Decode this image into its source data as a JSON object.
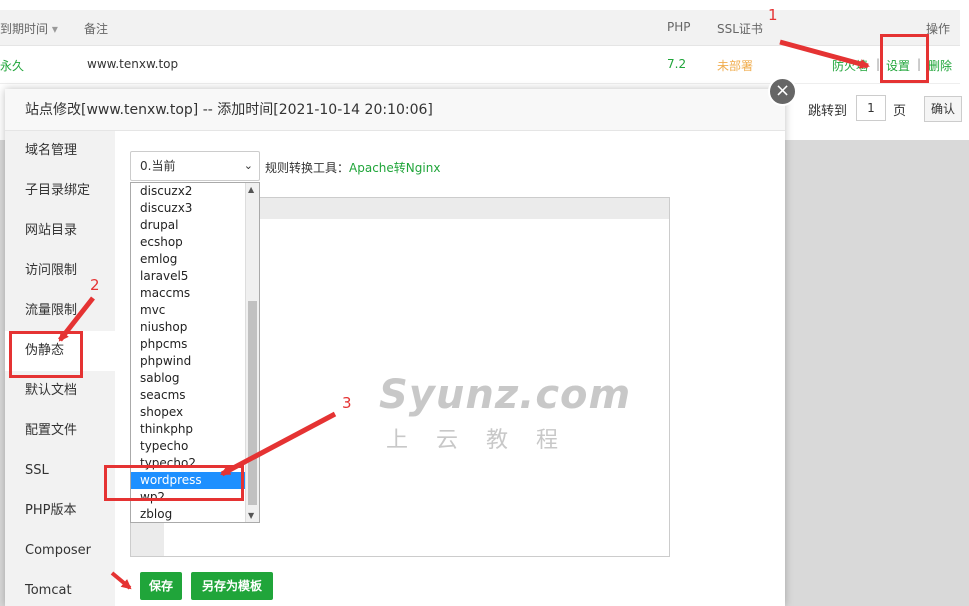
{
  "table": {
    "headers": {
      "expire": "到期时间",
      "note": "备注",
      "php": "PHP",
      "ssl": "SSL证书",
      "ops": "操作"
    },
    "row": {
      "expire": "永久",
      "note": "www.tenxw.top",
      "php": "7.2",
      "ssl": "未部署",
      "op_firewall": "防火墙",
      "op_settings": "设置",
      "op_delete": "删除",
      "sep": "|"
    }
  },
  "pager": {
    "jump": "跳转到",
    "page_value": "1",
    "page_unit": "页",
    "confirm": "确认"
  },
  "modal": {
    "title": "站点修改[www.tenxw.top] -- 添加时间[2021-10-14 20:10:06]",
    "close": "×",
    "nav": [
      "域名管理",
      "子目录绑定",
      "网站目录",
      "访问限制",
      "流量限制",
      "伪静态",
      "默认文档",
      "配置文件",
      "SSL",
      "PHP版本",
      "Composer",
      "Tomcat"
    ],
    "select_value": "0.当前",
    "convert_label": "规则转换工具：",
    "convert_link": "Apache转Nginx",
    "dropdown": [
      "discuzx2",
      "discuzx3",
      "drupal",
      "ecshop",
      "emlog",
      "laravel5",
      "maccms",
      "mvc",
      "niushop",
      "phpcms",
      "phpwind",
      "sablog",
      "seacms",
      "shopex",
      "thinkphp",
      "typecho",
      "typecho2",
      "wordpress",
      "wp2",
      "zblog"
    ],
    "save_btn": "保存",
    "save_tpl_btn": "另存为模板"
  },
  "watermark": {
    "main": "Syunz.com",
    "sub": "上云教程"
  },
  "annotations": {
    "n1": "1",
    "n2": "2",
    "n3": "3"
  },
  "colors": {
    "accent": "#20a53a",
    "annotation": "#e53333",
    "selected": "#1e90ff"
  }
}
